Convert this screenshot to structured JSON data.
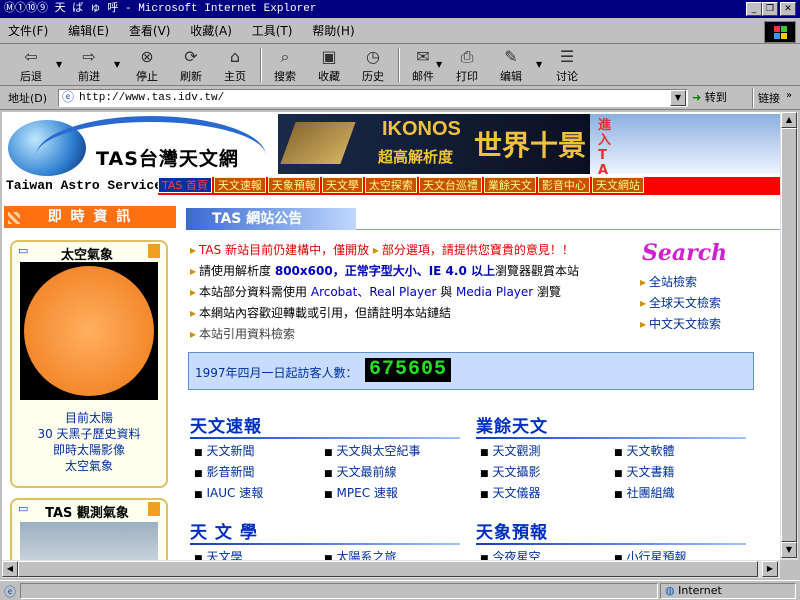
{
  "window": {
    "title": "Ⓜ①⑩⑨  天 ば ゅ 呼 - Microsoft Internet Explorer",
    "min": "_",
    "max": "❐",
    "close": "✕"
  },
  "menu": [
    "文件(F)",
    "编辑(E)",
    "查看(V)",
    "收藏(A)",
    "工具(T)",
    "帮助(H)"
  ],
  "toolbar": [
    {
      "label": "后退",
      "icon": "back-arrow-icon",
      "glyph": "⇦"
    },
    {
      "label": "前进",
      "icon": "forward-arrow-icon",
      "glyph": "⇨"
    },
    {
      "label": "停止",
      "icon": "stop-icon",
      "glyph": "⊗"
    },
    {
      "label": "刷新",
      "icon": "refresh-icon",
      "glyph": "⟳"
    },
    {
      "label": "主页",
      "icon": "home-icon",
      "glyph": "⌂"
    },
    {
      "label": "搜索",
      "icon": "search-icon",
      "glyph": "⌕"
    },
    {
      "label": "收藏",
      "icon": "favorites-icon",
      "glyph": "▣"
    },
    {
      "label": "历史",
      "icon": "history-icon",
      "glyph": "◷"
    },
    {
      "label": "邮件",
      "icon": "mail-icon",
      "glyph": "✉"
    },
    {
      "label": "打印",
      "icon": "print-icon",
      "glyph": "⎙"
    },
    {
      "label": "编辑",
      "icon": "edit-icon",
      "glyph": "✎"
    },
    {
      "label": "讨论",
      "icon": "discuss-icon",
      "glyph": "☰"
    }
  ],
  "address": {
    "label": "地址(D)",
    "url": "http://www.tas.idv.tw/",
    "go": "转到",
    "links": "链接"
  },
  "site": {
    "logo_title": "TAS台灣天文網",
    "logo_sub": "Taiwan Astro Service",
    "banner_text1": "IKONOS",
    "banner_text2": "超高解析度",
    "banner_text3": "世界十景",
    "banner_side": "進入TAS",
    "nav": [
      "TAS 首頁",
      "天文速報",
      "天象預報",
      "天文學",
      "太空探索",
      "天文台巡禮",
      "業餘天文",
      "影音中心",
      "天文網站"
    ],
    "left_header": "即 時 資 訊",
    "panel1_title": "太空氣象",
    "panel1_links": [
      "目前太陽",
      "30 天黑子歷史資料",
      "即時太陽影像",
      "太空氣象"
    ],
    "panel2_title": "TAS 觀測氣象",
    "notice_header": "TAS 網站公告",
    "notices": [
      {
        "a": "TAS 新站目前仍建構中，僅開放",
        "b": "部分選項，請提供您寶貴的意見！！"
      },
      {
        "a": "請使用解析度 ",
        "b": "800x600，正常字型大小、IE 4.0 以上",
        "c": "瀏覽器觀賞本站"
      },
      {
        "a": "本站部分資料需使用 ",
        "b": "Arcobat、Real Player",
        "c": " 與 ",
        "d": "Media Player",
        "e": " 瀏覽"
      },
      {
        "a": "本網站內容歡迎轉載或引用，但請註明本站鏈結"
      },
      {
        "a": "本站引用資料檢索"
      }
    ],
    "search_title": "Search",
    "search_links": [
      "全站檢索",
      "全球天文檢索",
      "中文天文檢索"
    ],
    "counter_label": "1997年四月一日起訪客人數：",
    "counter_value": "675605",
    "sections": [
      {
        "title": "天文速報",
        "items": [
          "天文新聞",
          "天文與太空紀事",
          "影音新聞",
          "天文最前線",
          "IAUC 速報",
          "MPEC 速報"
        ]
      },
      {
        "title": "業餘天文",
        "items": [
          "天文觀測",
          "天文軟體",
          "天文攝影",
          "天文書籍",
          "天文儀器",
          "社團組織"
        ]
      },
      {
        "title": "天 文 學",
        "items": [
          "天文學",
          "太陽系之旅"
        ]
      },
      {
        "title": "天象預報",
        "items": [
          "今夜星空",
          "小行星預報"
        ]
      }
    ]
  },
  "status": {
    "zone": "Internet"
  }
}
